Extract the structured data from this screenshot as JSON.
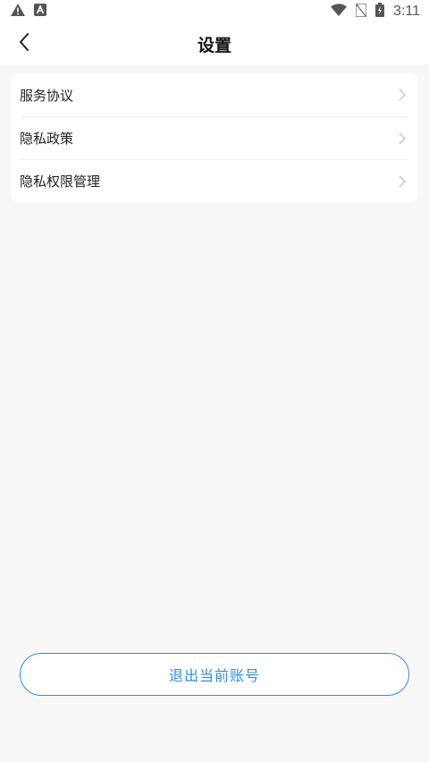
{
  "status_bar": {
    "time": "3:11",
    "icons_left": [
      "warning-icon",
      "a-notification-icon"
    ],
    "icons_right": [
      "wifi-icon",
      "no-sim-icon",
      "battery-charging-icon"
    ]
  },
  "header": {
    "title": "设置",
    "back_icon": "chevron-left-icon"
  },
  "menu": {
    "items": [
      {
        "label": "服务协议"
      },
      {
        "label": "隐私政策"
      },
      {
        "label": "隐私权限管理"
      }
    ]
  },
  "logout": {
    "label": "退出当前账号"
  },
  "colors": {
    "accent": "#2d8fe0",
    "background": "#f7f7f7",
    "card": "#ffffff"
  }
}
